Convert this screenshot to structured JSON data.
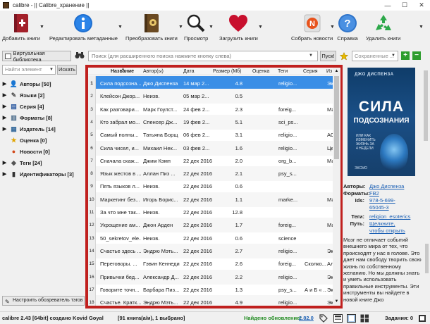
{
  "window": {
    "title": "calibre - || Calibre_хранение ||",
    "minimize": "—",
    "maximize": "☐",
    "close": "✕"
  },
  "toolbar": {
    "add": "Добавить книги",
    "edit": "Редактировать метаданные",
    "convert": "Преобразовать книги",
    "view": "Просмотр",
    "get": "Загрузить книги",
    "news": "Собрать новости",
    "help": "Справка",
    "remove": "Удалить книги"
  },
  "search": {
    "virtual_library": "Виртуальная библиотека",
    "placeholder": "Поиск (для расширенного поиска нажмите кнопку слева)",
    "go": "Пуск!",
    "saved_placeholder": "Сохраненные ...",
    "plus": "+",
    "minus": "−"
  },
  "tag_browser": {
    "find_placeholder": "Найти элемент",
    "find_button": "Искать",
    "items": [
      {
        "label": "Авторы [50]",
        "icon": "person-icon",
        "glyph": "👤",
        "color": "#444"
      },
      {
        "label": "Языки [2]",
        "icon": "languages-icon",
        "glyph": "✎",
        "color": "#555"
      },
      {
        "label": "Серия [4]",
        "icon": "series-icon",
        "glyph": "▤",
        "color": "#2c5aa0"
      },
      {
        "label": "Форматы [8]",
        "icon": "formats-icon",
        "glyph": "▥",
        "color": "#4a6b8a"
      },
      {
        "label": "Издатель [14]",
        "icon": "publisher-icon",
        "glyph": "▦",
        "color": "#3b6e9e"
      },
      {
        "label": "Оценка [0]",
        "icon": "rating-icon",
        "glyph": "★",
        "color": "#e0a400"
      },
      {
        "label": "Новости [0]",
        "icon": "news-icon",
        "glyph": "●",
        "color": "#d24a1b"
      },
      {
        "label": "Теги [24]",
        "icon": "tags-icon",
        "glyph": "◆",
        "color": "#555"
      },
      {
        "label": "Идентификаторы [3]",
        "icon": "barcode-icon",
        "glyph": "▮",
        "color": "#333"
      }
    ],
    "configure": "Настроить обозреватель тэгов"
  },
  "table": {
    "columns": [
      "Название",
      "Автор(ы)",
      "Дата",
      "Размер (Мб)",
      "Оценка",
      "Теги",
      "Серия",
      "Из"
    ],
    "rows": [
      {
        "n": "1",
        "title": "Сила подсозна...",
        "author": "Джо Диспенза",
        "date": "14 мар 2...",
        "size": "4.8",
        "tags": "religio...",
        "series": "",
        "pub": "Экс"
      },
      {
        "n": "2",
        "title": "Клейсон Джор...",
        "author": "Неизв.",
        "date": "05 мар 2...",
        "size": "0.5",
        "tags": "",
        "series": "",
        "pub": ""
      },
      {
        "n": "3",
        "title": "Как разговари...",
        "author": "Марк Гоулст...",
        "date": "24 фев 2...",
        "size": "2.3",
        "tags": "foreig...",
        "series": "",
        "pub": "Ман"
      },
      {
        "n": "4",
        "title": "Кто забрал мо...",
        "author": "Спенсер Дж...",
        "date": "19 фев 2...",
        "size": "5.1",
        "tags": "sci_ps...",
        "series": "",
        "pub": ""
      },
      {
        "n": "5",
        "title": "Самый полны...",
        "author": "Татьяна Борщ",
        "date": "06 фев 2...",
        "size": "3.1",
        "tags": "religio...",
        "series": "",
        "pub": "АСТ"
      },
      {
        "n": "6",
        "title": "Сила чисел, и...",
        "author": "Михаил Нек...",
        "date": "03 фев 2...",
        "size": "1.6",
        "tags": "religio...",
        "series": "",
        "pub": "Цен"
      },
      {
        "n": "7",
        "title": "Сначала скаж...",
        "author": "Джим Кэмп",
        "date": "22 дек 2016",
        "size": "2.0",
        "tags": "org_b...",
        "series": "",
        "pub": "Ман"
      },
      {
        "n": "8",
        "title": "Язык жестов в ...",
        "author": "Аллан Пиз ...",
        "date": "22 дек 2016",
        "size": "2.1",
        "tags": "psy_s...",
        "series": "",
        "pub": ""
      },
      {
        "n": "9",
        "title": "Пять языков л...",
        "author": "Неизв.",
        "date": "22 дек 2016",
        "size": "0.6",
        "tags": "",
        "series": "",
        "pub": ""
      },
      {
        "n": "10",
        "title": "Маркетинг без...",
        "author": "Игорь Борис...",
        "date": "22 дек 2016",
        "size": "1.1",
        "tags": "marke...",
        "series": "",
        "pub": "Ман"
      },
      {
        "n": "11",
        "title": "За что мне так...",
        "author": "Неизв.",
        "date": "22 дек 2016",
        "size": "12.8",
        "tags": "",
        "series": "",
        "pub": ""
      },
      {
        "n": "12",
        "title": "Укрощение ам...",
        "author": "Джон Арден",
        "date": "22 дек 2016",
        "size": "1.7",
        "tags": "foreig...",
        "series": "",
        "pub": "Ман"
      },
      {
        "n": "13",
        "title": "50_sekretov_ele...",
        "author": "Неизв.",
        "date": "22 дек 2016",
        "size": "0.6",
        "tags": "science",
        "series": "",
        "pub": ""
      },
      {
        "n": "14",
        "title": "Счастье здесь ...",
        "author": "Эндрю Мэть...",
        "date": "22 дек 2016",
        "size": "2.7",
        "tags": "religio...",
        "series": "",
        "pub": "Экс"
      },
      {
        "n": "15",
        "title": "Переговоры. ...",
        "author": "Гэвин Кеннеди",
        "date": "22 дек 2016",
        "size": "2.6",
        "tags": "foreig...",
        "series": "Сколко...",
        "pub": "Аль"
      },
      {
        "n": "16",
        "title": "Привычки бед...",
        "author": "Александр Д...",
        "date": "22 дек 2016",
        "size": "2.2",
        "tags": "religio...",
        "series": "",
        "pub": "Экс"
      },
      {
        "n": "17",
        "title": "Говорите точн...",
        "author": "Барбара Пиз...",
        "date": "22 дек 2016",
        "size": "1.3",
        "tags": "psy_s...",
        "series": "А и Б « ...",
        "pub": "Эксм"
      },
      {
        "n": "18",
        "title": "Счастье. Кратк...",
        "author": "Эндрю Мэть...",
        "date": "22 дек 2016",
        "size": "4.9",
        "tags": "religio...",
        "series": "",
        "pub": "Экс"
      }
    ]
  },
  "cover": {
    "author": "ДЖО ДИСПЕНЗА",
    "title_1": "СИЛА",
    "title_2": "ПОДСОЗНАНИЯ",
    "subtitle": "ИЛИ КАК ИЗМЕНИТЬ ЖИЗНЬ ЗА 4 НЕДЕЛИ",
    "publisher": "ЭКСМО"
  },
  "details": {
    "authors_key": "Авторы:",
    "authors_val": "Джо Диспенза",
    "formats_key": "Форматы:",
    "formats_val": "FB2",
    "ids_key": "Ids:",
    "ids_val_1": "978-5-699-",
    "ids_val_2": "65045-3",
    "tags_key": "Теги:",
    "tags_val": "religion_esoterics",
    "path_key": "Путь:",
    "path_val_1": "Щелкните,",
    "path_val_2": "чтобы открыть",
    "description": "Мозг не отличает событий внешнего мира от тех, что происходят у нас в голове. Это дает нам свободу творить свою жизнь по собственному желанию. Но мы должны знать и уметь использовать правильные инструменты. Эти инструменты вы найдете в новой книге Джо"
  },
  "status": {
    "version": "calibre 2.43 [64bit] создано Kovid Goyal",
    "count": "[91 книга(а/и), 1 выбрано]",
    "update_label": "Найдено обновление:",
    "update_version": "2.82.0",
    "jobs": "Задания: 0"
  }
}
